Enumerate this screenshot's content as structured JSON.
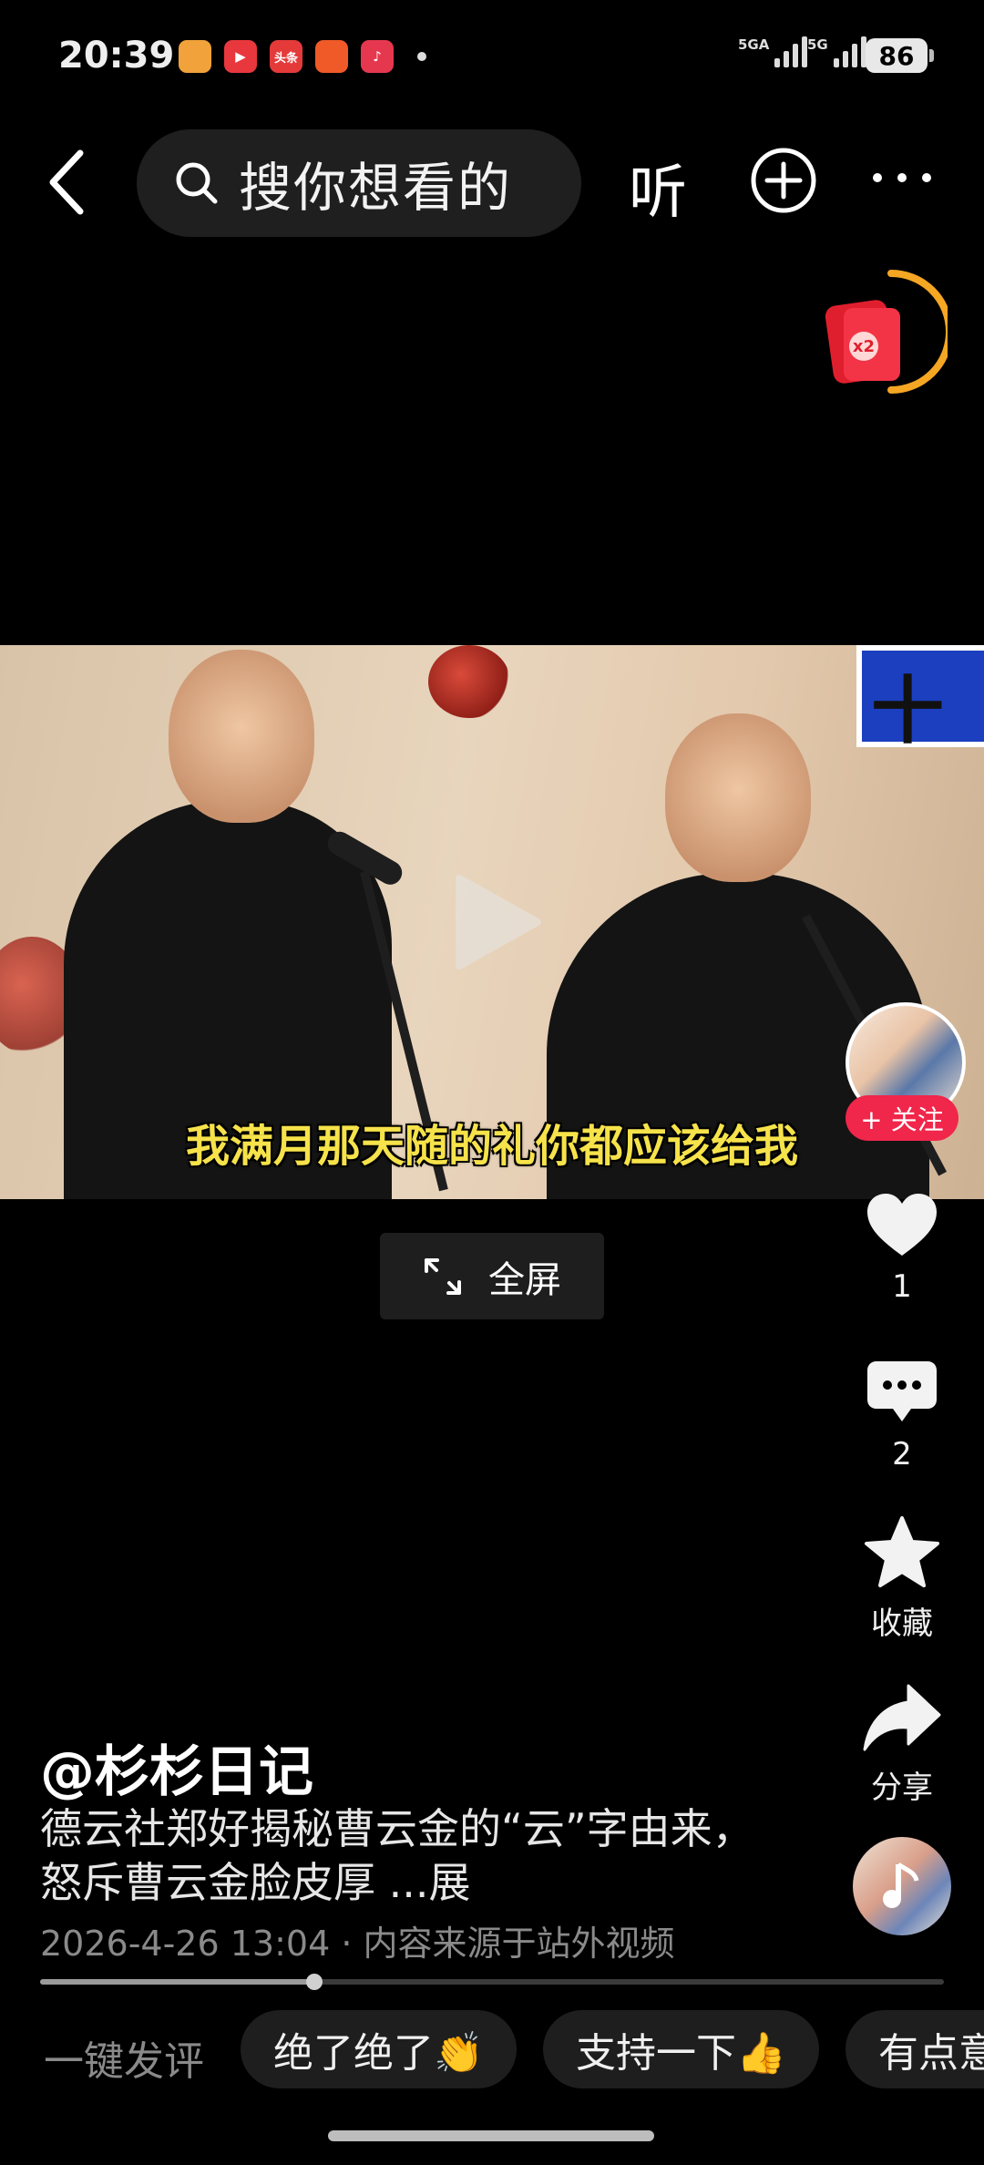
{
  "status_bar": {
    "time": "20:39",
    "apps": [
      {
        "name": "app-icon",
        "color": "#f2a23a",
        "text": ""
      },
      {
        "name": "video-app-icon",
        "color": "#e8383d",
        "text": "▶"
      },
      {
        "name": "toutiao-icon",
        "color": "#e43a3a",
        "text": "头条"
      },
      {
        "name": "shopping-app-icon",
        "color": "#f05a28",
        "text": ""
      },
      {
        "name": "music-app-icon",
        "color": "#e5384f",
        "text": "♪"
      }
    ],
    "signal1_label": "5GA",
    "signal2_label": "5G",
    "battery": "86"
  },
  "nav": {
    "search_placeholder": "搜你想看的",
    "listen_label": "听"
  },
  "reward": {
    "label": "x2"
  },
  "video": {
    "subtitle": "我满月那天随的礼你都应该给我",
    "sign_text": "十"
  },
  "fullscreen_label": "全屏",
  "actions": {
    "follow_label": "+ 关注",
    "like_count": "1",
    "comment_count": "2",
    "favorite_label": "收藏",
    "share_label": "分享"
  },
  "post": {
    "author": "@杉杉日记",
    "description": "德云社郑好揭秘曹云金的“云”字由来，怒斥曹云金脸皮厚 ...展",
    "meta": "2026-4-26 13:04 · 内容来源于站外视频",
    "progress": 0.303
  },
  "quick_comments": {
    "label": "一键发评",
    "chips": [
      "绝了绝了👏",
      "支持一下👍",
      "有点意"
    ]
  },
  "colors": {
    "accent": "#f0264a",
    "subtitle": "#f6e24a",
    "reward_ring": "#f5a623"
  }
}
